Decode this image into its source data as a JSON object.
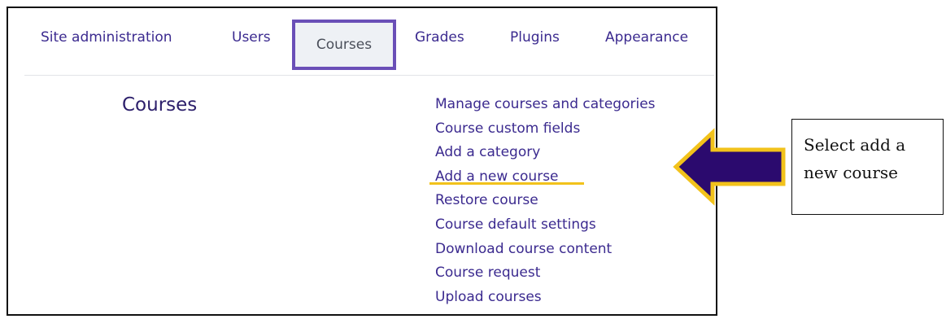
{
  "nav": {
    "tabs": [
      {
        "label": "Site administration"
      },
      {
        "label": "Users"
      },
      {
        "label": "Courses",
        "active": true
      },
      {
        "label": "Grades"
      },
      {
        "label": "Plugins"
      },
      {
        "label": "Appearance"
      }
    ]
  },
  "main": {
    "section_title": "Courses",
    "links": [
      "Manage courses and categories",
      "Course custom fields",
      "Add a category",
      "Add a new course",
      "Restore course",
      "Course default settings",
      "Download course content",
      "Course request",
      "Upload courses"
    ]
  },
  "annotation": {
    "callout_text": "Select add a new course",
    "arrow_icon": "arrow-left-icon",
    "highlight_target": "Add a new course",
    "colors": {
      "arrow_fill": "#2b0a6e",
      "arrow_outline": "#f2c21b",
      "underline": "#f2c21b",
      "active_tab_border": "#6a4fb7",
      "link": "#3b2a8f"
    }
  }
}
